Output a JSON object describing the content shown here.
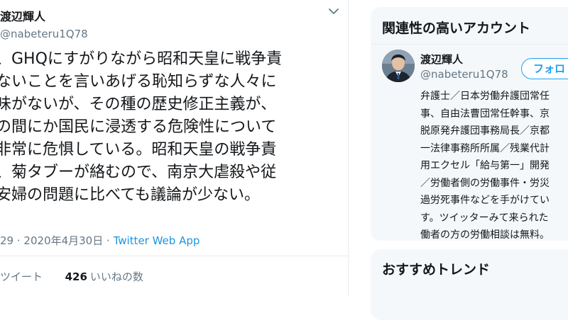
{
  "tweet": {
    "author_name": "渡辺輝人",
    "author_handle": "@nabeteru1Q78",
    "text_lines": [
      "、GHQにすがりながら昭和天皇に戦争責",
      "ないことを言いあげる恥知らずな人々に",
      "味がないが、その種の歴史修正主義が、",
      "の間にか国民に浸透する危険性について",
      "非常に危惧している。昭和天皇の戦争責",
      "、菊タブーが絡むので、南京大虐殺や従",
      "安婦の問題に比べても議論が少ない。"
    ],
    "time": "29",
    "date": "2020年4月30日",
    "source": "Twitter Web App",
    "retweet_label": "ツイート",
    "likes_count": "426",
    "likes_label": "いいねの数"
  },
  "sidebar": {
    "related_title": "関連性の高いアカウント",
    "account": {
      "name": "渡辺輝人",
      "handle": "@nabeteru1Q78",
      "follow_label": "フォロ",
      "bio_lines": [
        "弁護士／日本労働弁護団常任",
        "事、自由法曹団常任幹事、京",
        "脱原発弁護団事務局長／京都",
        "一法律事務所所属／残業代計",
        "用エクセル「給与第一」開発",
        "／労働者側の労働事件・労災",
        "過労死事件などを手がけてい",
        "す。ツイッターみて来られた",
        "働者の方の労働相談は無料。"
      ]
    },
    "trends_title": "おすすめトレンド"
  },
  "colors": {
    "accent": "#1da1f2",
    "secondary_text": "#657786",
    "panel_bg": "#f5f8fa"
  },
  "icons": {
    "caret": "chevron-down-icon"
  }
}
